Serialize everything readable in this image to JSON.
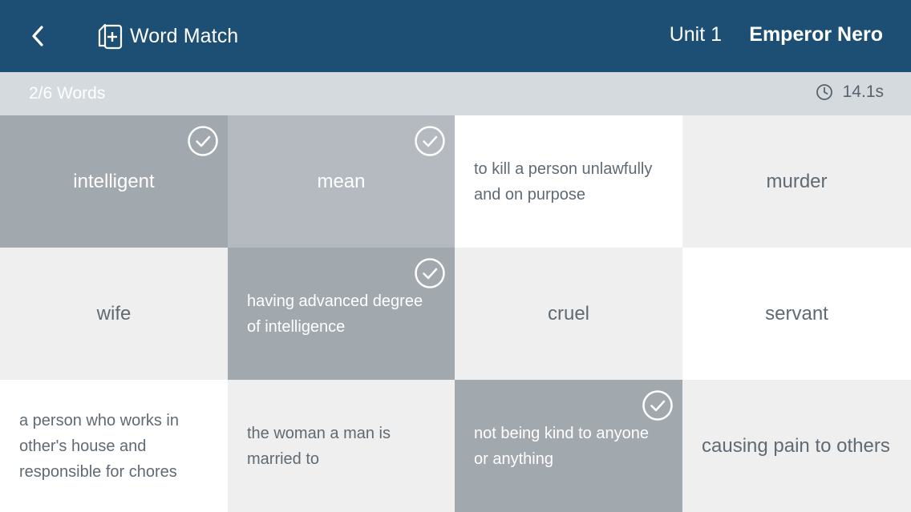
{
  "header": {
    "app_title": "Word Match",
    "unit": "Unit 1",
    "lesson": "Emperor Nero",
    "icons": {
      "back": "chevron-left-icon",
      "app": "card-plus-icon"
    }
  },
  "status": {
    "progress": "2/6 Words",
    "timer": "14.1s",
    "icon": "clock-icon"
  },
  "colors": {
    "header_bg": "#1d4f74",
    "status_bg": "#d5dadf",
    "matched_card": "#a5acb2",
    "light_card": "#efefef",
    "white_card": "#ffffff"
  },
  "cards": [
    {
      "text": "intelligent",
      "matched": true
    },
    {
      "text": "mean",
      "matched": true
    },
    {
      "text": "to kill a person unlawfully and on purpose",
      "matched": false
    },
    {
      "text": "murder",
      "matched": false
    },
    {
      "text": "wife",
      "matched": false
    },
    {
      "text": "having advanced degree of intelligence",
      "matched": true
    },
    {
      "text": "cruel",
      "matched": false
    },
    {
      "text": "servant",
      "matched": false
    },
    {
      "text": "a person who works in other's house and responsible for chores",
      "matched": false
    },
    {
      "text": "the woman a man is married to",
      "matched": false
    },
    {
      "text": "not being kind to anyone or anything",
      "matched": true
    },
    {
      "text": "causing pain to others",
      "matched": false
    }
  ]
}
